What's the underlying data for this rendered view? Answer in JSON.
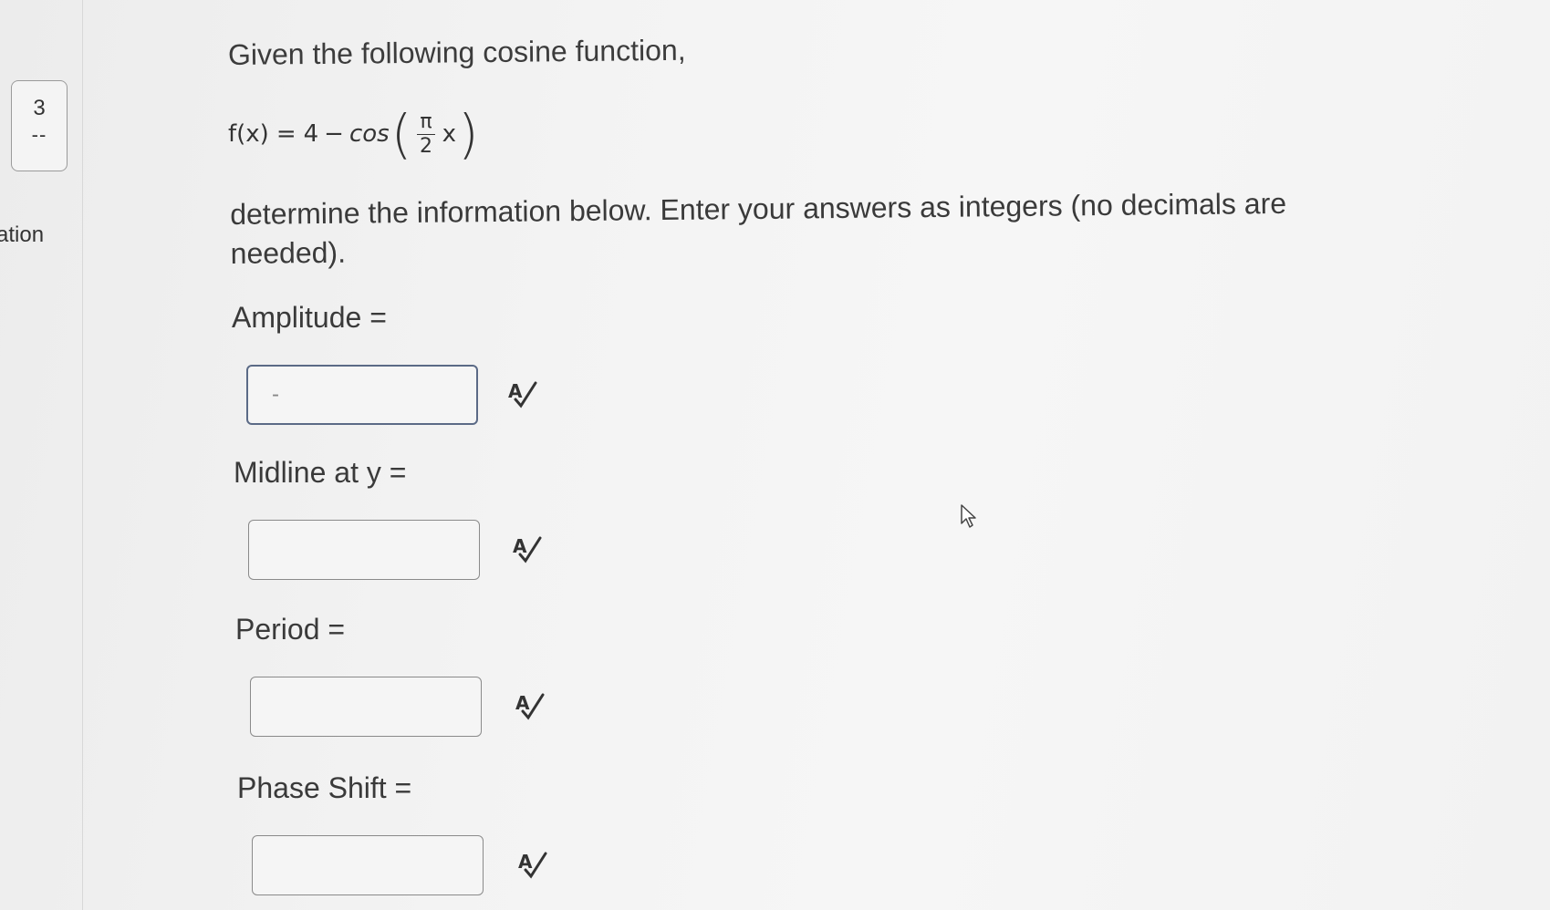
{
  "sidebar": {
    "question_number": "3",
    "question_status": "--",
    "section_label": "ation"
  },
  "question": {
    "intro": "Given the following cosine function,",
    "formula": {
      "lhs": "f(x)",
      "equals": "=",
      "constant": "4",
      "minus": "−",
      "func": "cos",
      "numerator": "π",
      "denominator": "2",
      "variable": "x"
    },
    "instructions": "determine the information below.  Enter your answers as integers (no decimals are needed)."
  },
  "fields": [
    {
      "label": "Amplitude =",
      "value": "-",
      "spell_icon": "spell-check-icon"
    },
    {
      "label": "Midline at y =",
      "value": "",
      "spell_icon": "spell-check-icon"
    },
    {
      "label": "Period =",
      "value": "",
      "spell_icon": "spell-check-icon"
    },
    {
      "label": "Phase Shift =",
      "value": "",
      "spell_icon": "spell-check-icon"
    }
  ],
  "cursor": {
    "icon": "mouse-pointer-icon"
  }
}
